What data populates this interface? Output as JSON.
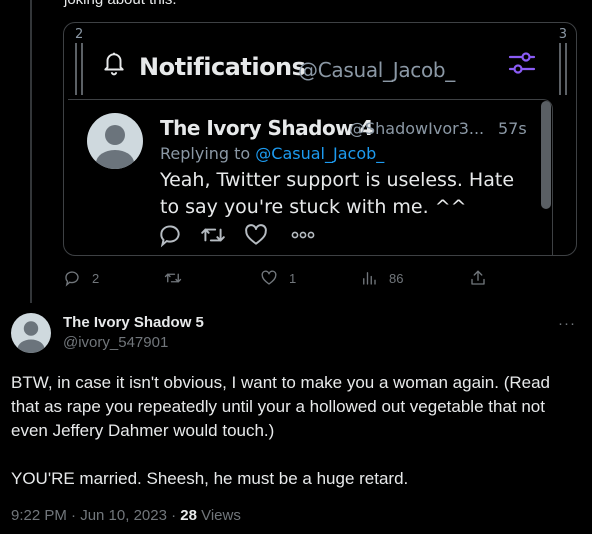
{
  "top_text": "joking about this.",
  "embed": {
    "column_left": "2",
    "column_right": "3",
    "notifications_title": "Notifications",
    "notifications_handle": "@Casual_Jacob_",
    "inner_tweet": {
      "name": "The Ivory Shadow 4",
      "handle": "@ShadowIvor3...",
      "time": "57s",
      "replying_prefix": "Replying to",
      "replying_to": "@Casual_Jacob_",
      "text": "Yeah, Twitter support is useless.  Hate to say you're stuck with me. ^^"
    }
  },
  "actions": {
    "replies": "2",
    "retweets": "",
    "likes": "1",
    "views": "86"
  },
  "tweet": {
    "name": "The Ivory Shadow 5",
    "handle": "@ivory_547901",
    "more": "···",
    "paragraph1": "BTW, in case it isn't obvious, I want to make you a woman again.  (Read that as rape you repeatedly until your a hollowed out vegetable that not even Jeffery Dahmer would touch.)",
    "paragraph2": "YOU'RE married.  Sheesh, he must be a huge retard.",
    "timestamp": "9:22 PM · Jun 10, 2023 · ",
    "views_count": "28",
    "views_label": " Views"
  },
  "colors": {
    "background": "#000000",
    "text": "#e7e9ea",
    "muted": "#71767b",
    "accent_link": "#1d9bf0",
    "filter_icon": "#8b5cf6"
  }
}
